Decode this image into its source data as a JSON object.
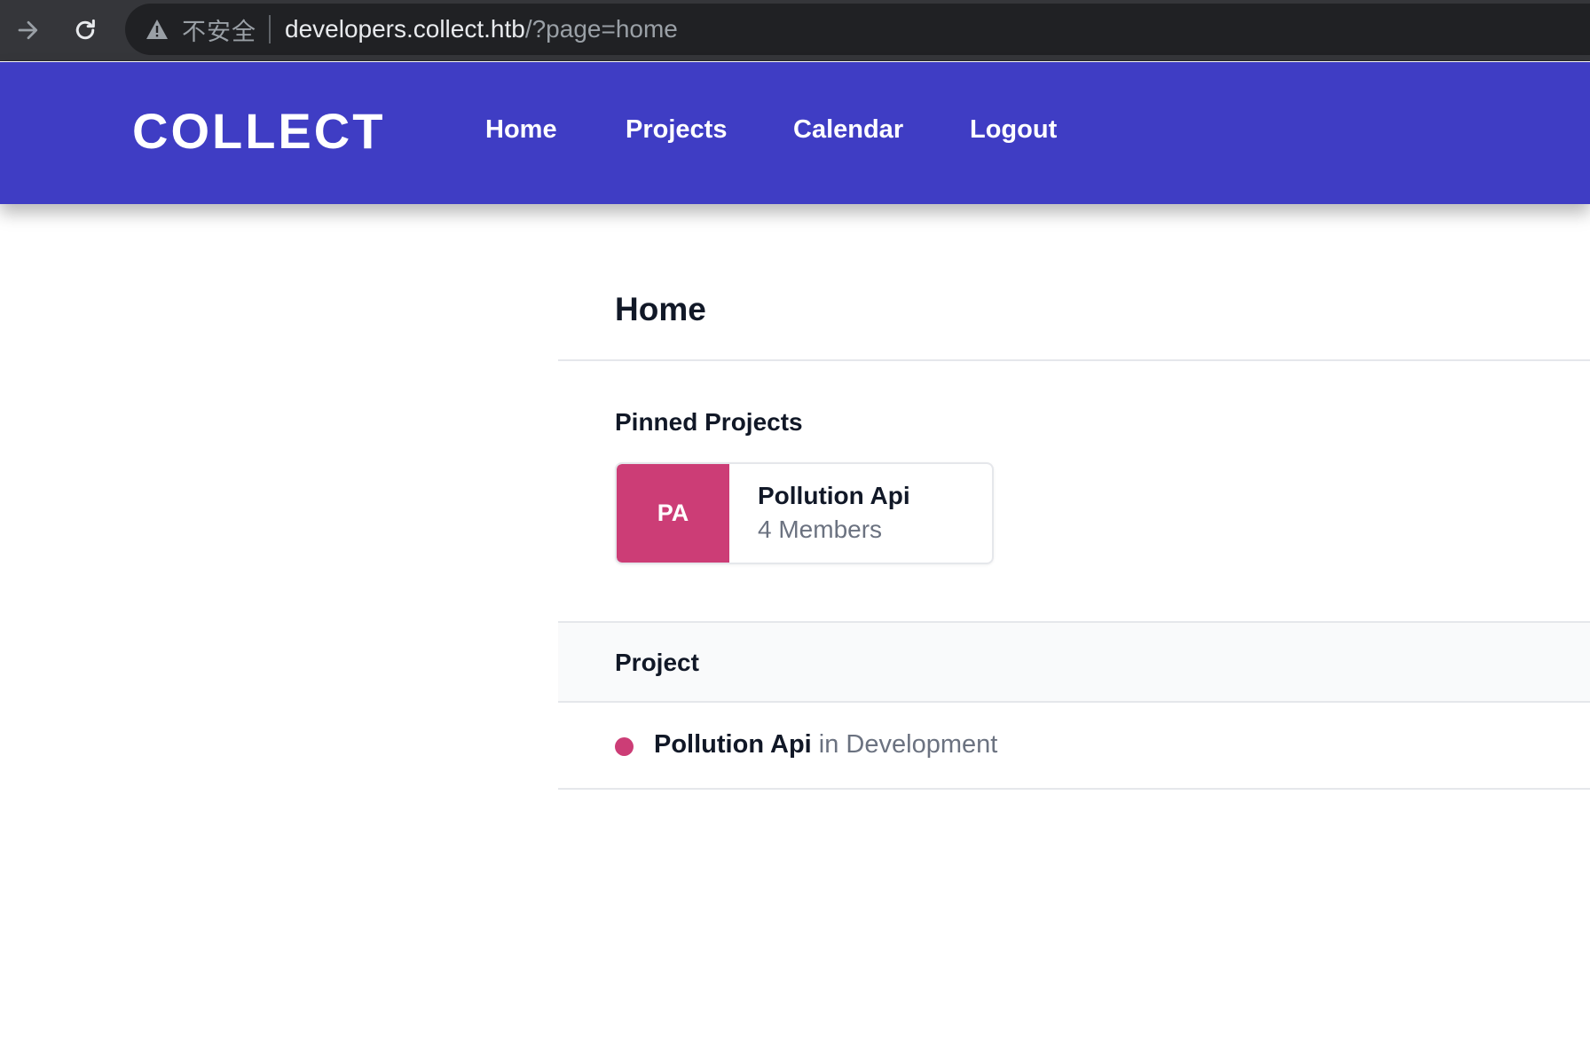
{
  "browser": {
    "security_label": "不安全",
    "url_host": "developers.collect.htb",
    "url_path": "/?page=home"
  },
  "header": {
    "brand": "COLLECT",
    "nav": {
      "home": "Home",
      "projects": "Projects",
      "calendar": "Calendar",
      "logout": "Logout"
    }
  },
  "main": {
    "title": "Home",
    "pinned_heading": "Pinned Projects",
    "pinned_card": {
      "initials": "PA",
      "name": "Pollution Api",
      "members": "4 Members",
      "color": "#cc3d76"
    },
    "table": {
      "column_header": "Project",
      "rows": [
        {
          "name": "Pollution Api",
          "status": "in Development",
          "dot_color": "#cc3d76"
        }
      ]
    }
  },
  "colors": {
    "header_bg": "#3f3dc4",
    "accent": "#cc3d76"
  }
}
